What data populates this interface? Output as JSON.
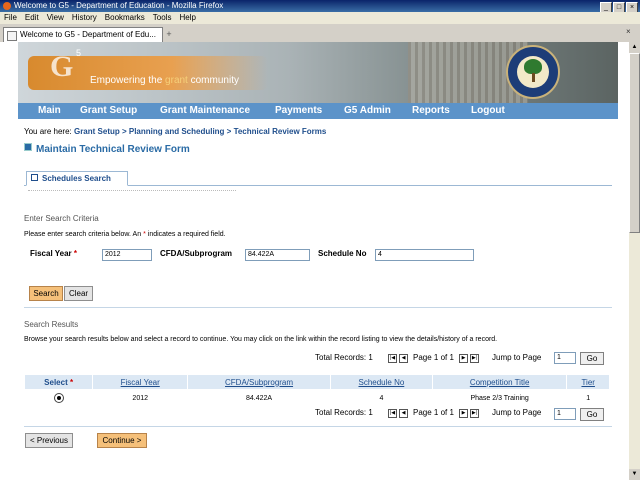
{
  "window": {
    "title": "Welcome to G5 - Department of Education - Mozilla Firefox"
  },
  "menu": [
    "File",
    "Edit",
    "View",
    "History",
    "Bookmarks",
    "Tools",
    "Help"
  ],
  "browser_tab": {
    "title": "Welcome to G5 - Department of Edu...",
    "new_tab": "+"
  },
  "banner": {
    "logo": "G",
    "logo_sup": "5",
    "tagline_pre": "Empowering the ",
    "tagline_em": "grant",
    "tagline_post": " community"
  },
  "nav": [
    "Main",
    "Grant Setup",
    "Grant Maintenance",
    "Payments",
    "G5 Admin",
    "Reports",
    "Logout"
  ],
  "breadcrumb": {
    "prefix": "You are here: ",
    "items": [
      "Grant Setup",
      "Planning and Scheduling",
      "Technical Review Forms"
    ],
    "sep": " > "
  },
  "page_title": "Maintain Technical Review Form",
  "subtab": "Schedules Search",
  "criteria": {
    "heading": "Enter Search Criteria",
    "note_pre": "Please enter search criteria below. An ",
    "note_star": "*",
    "note_post": " indicates a required field.",
    "fiscal_year_label": "Fiscal Year",
    "fiscal_year_value": "2012",
    "cfda_label": "CFDA/Subprogram",
    "cfda_value": "84.422A",
    "schedule_label": "Schedule No",
    "schedule_value": "4",
    "search_btn": "Search",
    "clear_btn": "Clear"
  },
  "results": {
    "heading": "Search Results",
    "note": "Browse your search results below and select a record to continue. You may click on the link within the record listing to view the details/history of a record.",
    "total_records": "Total Records: 1",
    "page_info": "Page 1 of 1",
    "jump_label": "Jump to Page",
    "jump_value": "1",
    "go": "Go",
    "columns": [
      "Select",
      "Fiscal Year",
      "CFDA/Subprogram",
      "Schedule No",
      "Competition Title",
      "Tier"
    ],
    "rows": [
      {
        "fiscal_year": "2012",
        "cfda": "84.422A",
        "schedule_no": "4",
        "title": "Phase 2/3 Training",
        "tier": "1"
      }
    ]
  },
  "footer": {
    "previous": "< Previous",
    "continue": "Continue >"
  }
}
